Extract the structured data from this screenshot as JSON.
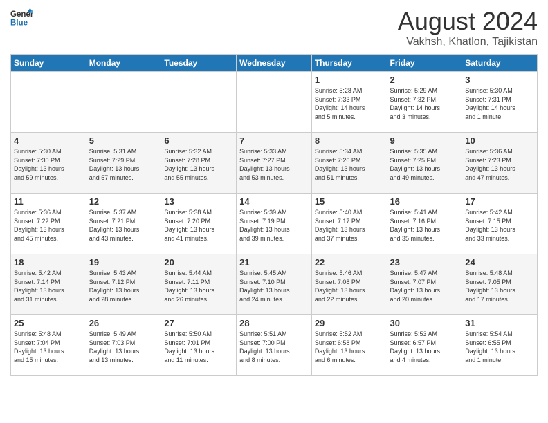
{
  "logo": {
    "line1": "General",
    "line2": "Blue"
  },
  "title": "August 2024",
  "subtitle": "Vakhsh, Khatlon, Tajikistan",
  "days_of_week": [
    "Sunday",
    "Monday",
    "Tuesday",
    "Wednesday",
    "Thursday",
    "Friday",
    "Saturday"
  ],
  "weeks": [
    [
      {
        "day": "",
        "info": ""
      },
      {
        "day": "",
        "info": ""
      },
      {
        "day": "",
        "info": ""
      },
      {
        "day": "",
        "info": ""
      },
      {
        "day": "1",
        "info": "Sunrise: 5:28 AM\nSunset: 7:33 PM\nDaylight: 14 hours\nand 5 minutes."
      },
      {
        "day": "2",
        "info": "Sunrise: 5:29 AM\nSunset: 7:32 PM\nDaylight: 14 hours\nand 3 minutes."
      },
      {
        "day": "3",
        "info": "Sunrise: 5:30 AM\nSunset: 7:31 PM\nDaylight: 14 hours\nand 1 minute."
      }
    ],
    [
      {
        "day": "4",
        "info": "Sunrise: 5:30 AM\nSunset: 7:30 PM\nDaylight: 13 hours\nand 59 minutes."
      },
      {
        "day": "5",
        "info": "Sunrise: 5:31 AM\nSunset: 7:29 PM\nDaylight: 13 hours\nand 57 minutes."
      },
      {
        "day": "6",
        "info": "Sunrise: 5:32 AM\nSunset: 7:28 PM\nDaylight: 13 hours\nand 55 minutes."
      },
      {
        "day": "7",
        "info": "Sunrise: 5:33 AM\nSunset: 7:27 PM\nDaylight: 13 hours\nand 53 minutes."
      },
      {
        "day": "8",
        "info": "Sunrise: 5:34 AM\nSunset: 7:26 PM\nDaylight: 13 hours\nand 51 minutes."
      },
      {
        "day": "9",
        "info": "Sunrise: 5:35 AM\nSunset: 7:25 PM\nDaylight: 13 hours\nand 49 minutes."
      },
      {
        "day": "10",
        "info": "Sunrise: 5:36 AM\nSunset: 7:23 PM\nDaylight: 13 hours\nand 47 minutes."
      }
    ],
    [
      {
        "day": "11",
        "info": "Sunrise: 5:36 AM\nSunset: 7:22 PM\nDaylight: 13 hours\nand 45 minutes."
      },
      {
        "day": "12",
        "info": "Sunrise: 5:37 AM\nSunset: 7:21 PM\nDaylight: 13 hours\nand 43 minutes."
      },
      {
        "day": "13",
        "info": "Sunrise: 5:38 AM\nSunset: 7:20 PM\nDaylight: 13 hours\nand 41 minutes."
      },
      {
        "day": "14",
        "info": "Sunrise: 5:39 AM\nSunset: 7:19 PM\nDaylight: 13 hours\nand 39 minutes."
      },
      {
        "day": "15",
        "info": "Sunrise: 5:40 AM\nSunset: 7:17 PM\nDaylight: 13 hours\nand 37 minutes."
      },
      {
        "day": "16",
        "info": "Sunrise: 5:41 AM\nSunset: 7:16 PM\nDaylight: 13 hours\nand 35 minutes."
      },
      {
        "day": "17",
        "info": "Sunrise: 5:42 AM\nSunset: 7:15 PM\nDaylight: 13 hours\nand 33 minutes."
      }
    ],
    [
      {
        "day": "18",
        "info": "Sunrise: 5:42 AM\nSunset: 7:14 PM\nDaylight: 13 hours\nand 31 minutes."
      },
      {
        "day": "19",
        "info": "Sunrise: 5:43 AM\nSunset: 7:12 PM\nDaylight: 13 hours\nand 28 minutes."
      },
      {
        "day": "20",
        "info": "Sunrise: 5:44 AM\nSunset: 7:11 PM\nDaylight: 13 hours\nand 26 minutes."
      },
      {
        "day": "21",
        "info": "Sunrise: 5:45 AM\nSunset: 7:10 PM\nDaylight: 13 hours\nand 24 minutes."
      },
      {
        "day": "22",
        "info": "Sunrise: 5:46 AM\nSunset: 7:08 PM\nDaylight: 13 hours\nand 22 minutes."
      },
      {
        "day": "23",
        "info": "Sunrise: 5:47 AM\nSunset: 7:07 PM\nDaylight: 13 hours\nand 20 minutes."
      },
      {
        "day": "24",
        "info": "Sunrise: 5:48 AM\nSunset: 7:05 PM\nDaylight: 13 hours\nand 17 minutes."
      }
    ],
    [
      {
        "day": "25",
        "info": "Sunrise: 5:48 AM\nSunset: 7:04 PM\nDaylight: 13 hours\nand 15 minutes."
      },
      {
        "day": "26",
        "info": "Sunrise: 5:49 AM\nSunset: 7:03 PM\nDaylight: 13 hours\nand 13 minutes."
      },
      {
        "day": "27",
        "info": "Sunrise: 5:50 AM\nSunset: 7:01 PM\nDaylight: 13 hours\nand 11 minutes."
      },
      {
        "day": "28",
        "info": "Sunrise: 5:51 AM\nSunset: 7:00 PM\nDaylight: 13 hours\nand 8 minutes."
      },
      {
        "day": "29",
        "info": "Sunrise: 5:52 AM\nSunset: 6:58 PM\nDaylight: 13 hours\nand 6 minutes."
      },
      {
        "day": "30",
        "info": "Sunrise: 5:53 AM\nSunset: 6:57 PM\nDaylight: 13 hours\nand 4 minutes."
      },
      {
        "day": "31",
        "info": "Sunrise: 5:54 AM\nSunset: 6:55 PM\nDaylight: 13 hours\nand 1 minute."
      }
    ]
  ]
}
